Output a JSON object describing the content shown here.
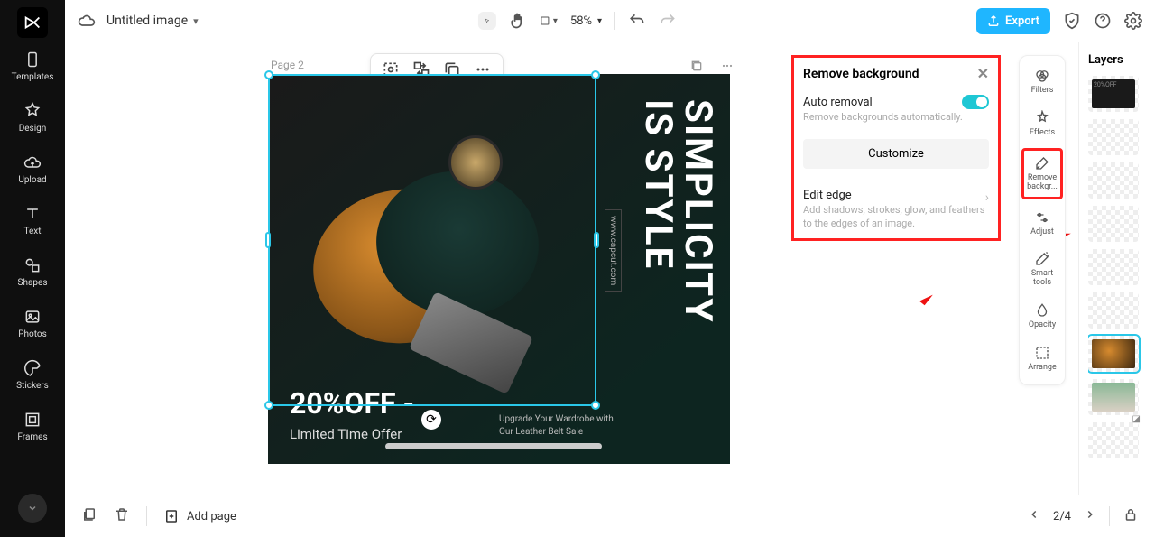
{
  "topbar": {
    "doc_title": "Untitled image",
    "zoom": "58%",
    "export": "Export"
  },
  "leftbar": {
    "items": [
      {
        "label": "Templates"
      },
      {
        "label": "Design"
      },
      {
        "label": "Upload"
      },
      {
        "label": "Text"
      },
      {
        "label": "Shapes"
      },
      {
        "label": "Photos"
      },
      {
        "label": "Stickers"
      },
      {
        "label": "Frames"
      }
    ]
  },
  "canvas": {
    "page_label": "Page 2",
    "big_text_line1": "SIMPLICITY",
    "big_text_line2": "IS STYLE",
    "url": "www.capcut.com",
    "off": "20%OFF",
    "limited": "Limited Time Offer",
    "upgrade_line1": "Upgrade Your Wardrobe with",
    "upgrade_line2": "Our Leather Belt Sale"
  },
  "rb_panel": {
    "title": "Remove background",
    "auto_title": "Auto removal",
    "auto_desc": "Remove backgrounds automatically.",
    "customize": "Customize",
    "edit_title": "Edit edge",
    "edit_desc": "Add shadows, strokes, glow, and feathers to the edges of an image."
  },
  "toolstrip": {
    "items": [
      {
        "label": "Filters"
      },
      {
        "label": "Effects"
      },
      {
        "label": "Remove backgr..."
      },
      {
        "label": "Adjust"
      },
      {
        "label": "Smart tools"
      },
      {
        "label": "Opacity"
      },
      {
        "label": "Arrange"
      }
    ]
  },
  "layers": {
    "title": "Layers",
    "thumbs_text": "20%OFF"
  },
  "bottombar": {
    "add_page": "Add page",
    "page_counter": "2/4"
  }
}
